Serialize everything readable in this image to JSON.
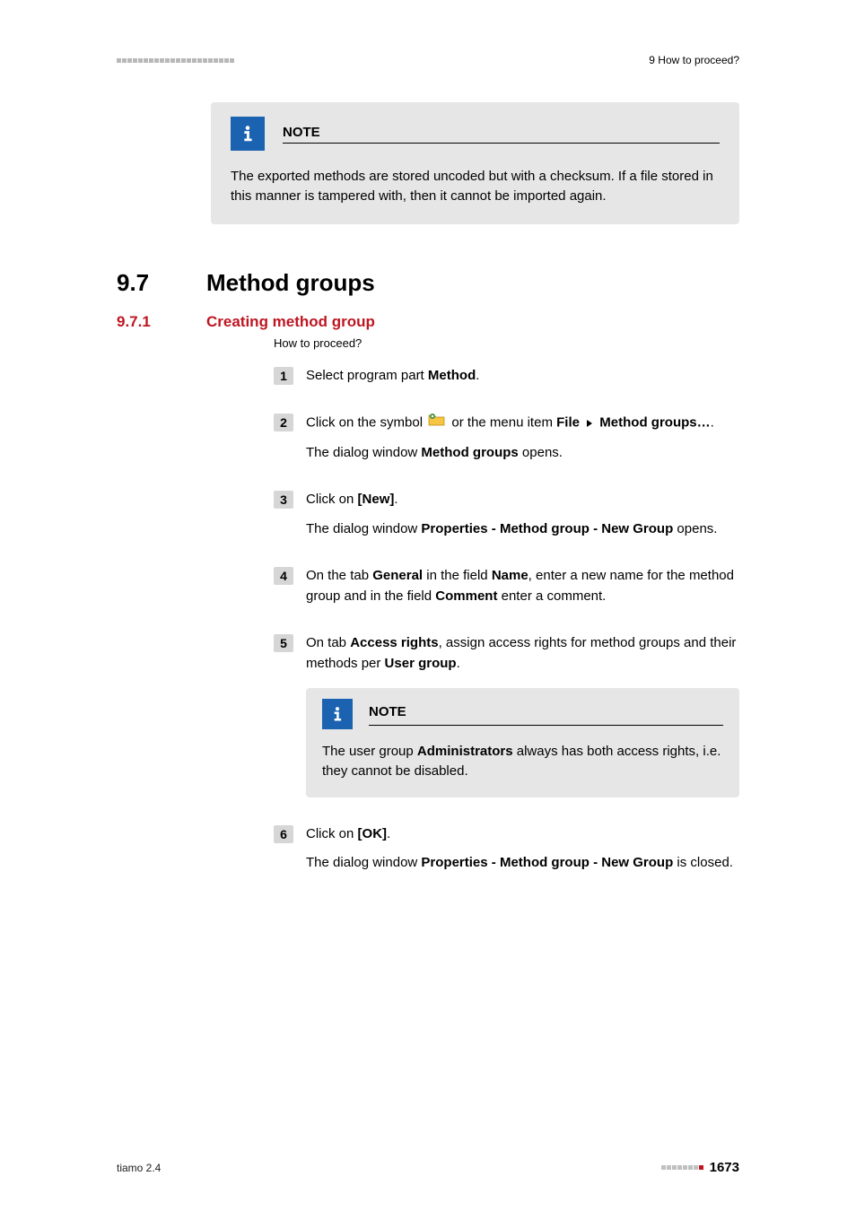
{
  "header": {
    "chapter": "9 How to proceed?"
  },
  "note1": {
    "title": "NOTE",
    "body": "The exported methods are stored uncoded but with a checksum. If a file stored in this manner is tampered with, then it cannot be imported again."
  },
  "section": {
    "num": "9.7",
    "title": "Method groups"
  },
  "subsection": {
    "num": "9.7.1",
    "title": "Creating method group",
    "howto": "How to proceed?"
  },
  "steps": {
    "s1": {
      "num": "1",
      "a": "Select program part ",
      "b": "Method",
      "c": "."
    },
    "s2": {
      "num": "2",
      "a": "Click on the symbol ",
      "b": " or the menu item ",
      "file": "File",
      "menu": "Method groups…",
      "d": ".",
      "sub_a": "The dialog window ",
      "sub_b": "Method groups",
      "sub_c": " opens."
    },
    "s3": {
      "num": "3",
      "a": "Click on ",
      "b": "[New]",
      "c": ".",
      "sub_a": "The dialog window ",
      "sub_b": "Properties - Method group - New Group",
      "sub_c": " opens."
    },
    "s4": {
      "num": "4",
      "a": "On the tab ",
      "b": "General",
      "c": " in the field ",
      "d": "Name",
      "e": ", enter a new name for the method group and in the field ",
      "f": "Comment",
      "g": " enter a comment."
    },
    "s5": {
      "num": "5",
      "a": "On tab ",
      "b": "Access rights",
      "c": ", assign access rights for method groups and their methods per ",
      "d": "User group",
      "e": "."
    },
    "s6": {
      "num": "6",
      "a": "Click on ",
      "b": "[OK]",
      "c": ".",
      "sub_a": "The dialog window ",
      "sub_b": "Properties - Method group - New Group",
      "sub_c": " is closed."
    }
  },
  "note2": {
    "title": "NOTE",
    "a": "The user group ",
    "b": "Administrators",
    "c": " always has both access rights, i.e. they cannot be disabled."
  },
  "footer": {
    "product": "tiamo 2.4",
    "page": "1673"
  }
}
